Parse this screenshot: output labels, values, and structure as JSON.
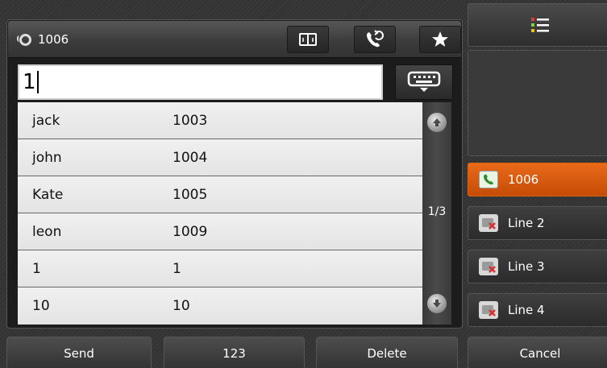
{
  "account": {
    "icon": "account-status-icon",
    "number": "1006"
  },
  "toolbar": {
    "directory_icon": "book-icon",
    "history_icon": "call-history-icon",
    "favorites_icon": "star-icon"
  },
  "search": {
    "value": "1",
    "keyboard_icon": "keyboard-icon"
  },
  "results": [
    {
      "name": "jack",
      "number": "1003"
    },
    {
      "name": "john",
      "number": "1004"
    },
    {
      "name": "Kate",
      "number": "1005"
    },
    {
      "name": "leon",
      "number": "1009"
    },
    {
      "name": "1",
      "number": "1"
    },
    {
      "name": "10",
      "number": "10"
    }
  ],
  "pager": {
    "indicator": "1/3"
  },
  "menu": {
    "icon": "menu-list-icon"
  },
  "line_keys": [
    {
      "label": "1006",
      "icon": "phone-handset-icon",
      "active": true,
      "color": "#d9580b"
    },
    {
      "label": "Line 2",
      "icon": "line-unregistered-icon",
      "active": false
    },
    {
      "label": "Line 3",
      "icon": "line-unregistered-icon",
      "active": false
    },
    {
      "label": "Line 4",
      "icon": "line-unregistered-icon",
      "active": false
    }
  ],
  "softkeys": {
    "send": "Send",
    "num": "123",
    "delete": "Delete",
    "cancel": "Cancel"
  }
}
